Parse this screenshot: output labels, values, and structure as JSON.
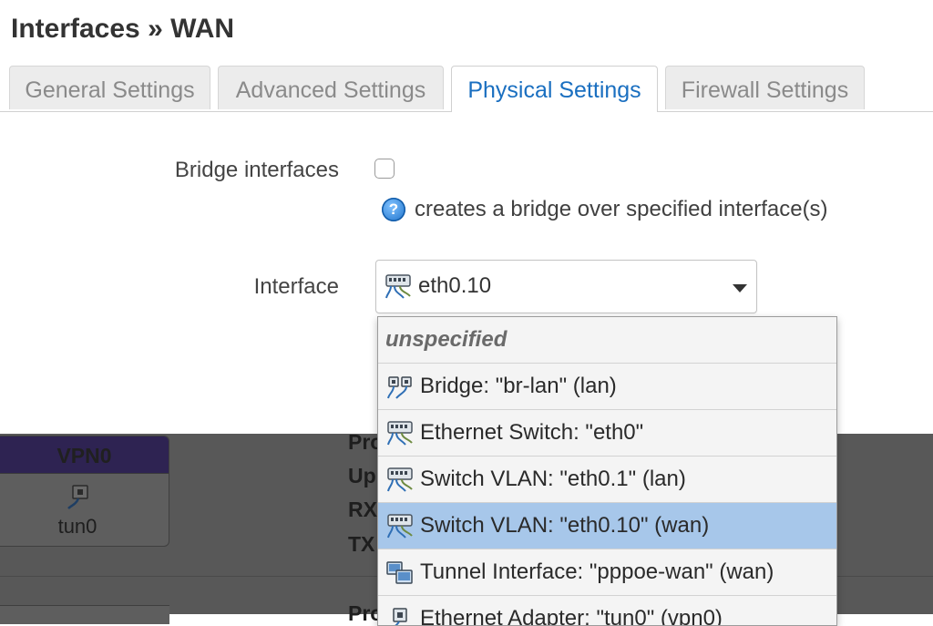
{
  "page": {
    "title": "Interfaces » WAN"
  },
  "tabs": [
    {
      "label": "General Settings",
      "active": false
    },
    {
      "label": "Advanced Settings",
      "active": false
    },
    {
      "label": "Physical Settings",
      "active": true
    },
    {
      "label": "Firewall Settings",
      "active": false
    }
  ],
  "form": {
    "bridge_label": "Bridge interfaces",
    "bridge_checked": false,
    "bridge_help": "creates a bridge over specified interface(s)",
    "help_icon_glyph": "?",
    "interface_label": "Interface",
    "interface_value": "eth0.10",
    "interface_icon": "ethernet-switch-icon"
  },
  "dropdown": {
    "options": [
      {
        "label": "unspecified",
        "icon": "",
        "selected": false
      },
      {
        "label": "Bridge: \"br-lan\" (lan)",
        "icon": "bridge-icon",
        "selected": false
      },
      {
        "label": "Ethernet Switch: \"eth0\"",
        "icon": "ethernet-switch-icon",
        "selected": false
      },
      {
        "label": "Switch VLAN: \"eth0.1\" (lan)",
        "icon": "ethernet-switch-icon",
        "selected": false
      },
      {
        "label": "Switch VLAN: \"eth0.10\" (wan)",
        "icon": "ethernet-switch-icon",
        "selected": true
      },
      {
        "label": "Tunnel Interface: \"pppoe-wan\" (wan)",
        "icon": "tunnel-icon",
        "selected": false
      },
      {
        "label": "Ethernet Adapter: \"tun0\" (vpn0)",
        "icon": "ethernet-adapter-icon",
        "selected": false
      }
    ]
  },
  "background": {
    "vpn_name": "VPN0",
    "vpn_device": "tun0",
    "side_labels": [
      "Pro",
      "Up",
      "RX",
      "TX",
      "Pro"
    ]
  },
  "colors": {
    "accent": "#1a6fc0",
    "selected_option": "#a7c7ea",
    "overlay": "#585858"
  }
}
